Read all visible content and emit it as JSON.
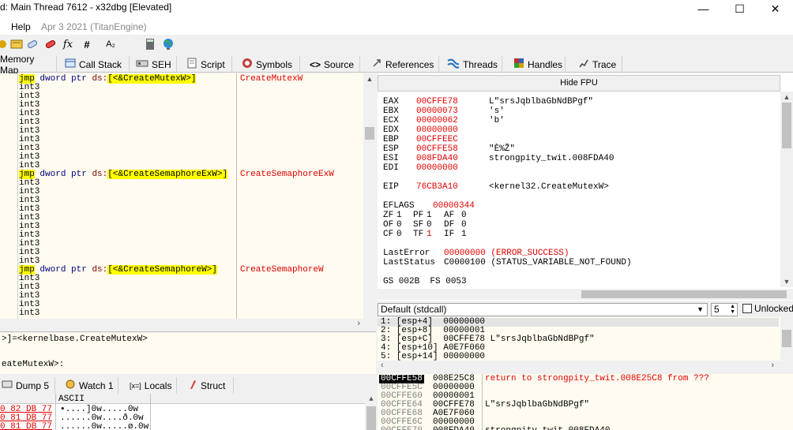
{
  "window": {
    "title": "d: Main Thread 7612 - x32dbg [Elevated]",
    "controls": [
      "—",
      "☐",
      "✕"
    ]
  },
  "menu": {
    "help": "Help",
    "build": "Apr 3 2021 (TitanEngine)"
  },
  "toolbar": {
    "icons": [
      "script-icon",
      "patch-icon",
      "bandaid-icon",
      "function-icon",
      "hash-icon",
      "font-size-icon",
      "calculator-icon",
      "globe-icon"
    ],
    "fx": "fx",
    "hash": "#",
    "font": "A₂"
  },
  "tabs": [
    {
      "label": "Memory Map",
      "icon": "memory-icon"
    },
    {
      "label": "Call Stack",
      "icon": "callstack-icon"
    },
    {
      "label": "SEH",
      "icon": "seh-icon"
    },
    {
      "label": "Script",
      "icon": "script-tab-icon"
    },
    {
      "label": "Symbols",
      "icon": "symbols-icon"
    },
    {
      "label": "Source",
      "icon": "source-icon"
    },
    {
      "label": "References",
      "icon": "references-icon"
    },
    {
      "label": "Threads",
      "icon": "threads-icon"
    },
    {
      "label": "Handles",
      "icon": "handles-icon"
    },
    {
      "label": "Trace",
      "icon": "trace-icon"
    }
  ],
  "disasm": {
    "rows": [
      {
        "type": "jmp",
        "mnemonic": "jmp",
        "kw": "dword ptr",
        "seg": "ds:",
        "target": "[<&CreateMutexW>]",
        "comment": "CreateMutexW"
      },
      {
        "type": "int3",
        "text": "int3"
      },
      {
        "type": "int3",
        "text": "int3"
      },
      {
        "type": "int3",
        "text": "int3"
      },
      {
        "type": "int3",
        "text": "int3"
      },
      {
        "type": "int3",
        "text": "int3"
      },
      {
        "type": "int3",
        "text": "int3"
      },
      {
        "type": "int3",
        "text": "int3"
      },
      {
        "type": "int3",
        "text": "int3"
      },
      {
        "type": "int3",
        "text": "int3"
      },
      {
        "type": "int3",
        "text": "int3"
      },
      {
        "type": "jmp",
        "mnemonic": "jmp",
        "kw": "dword ptr",
        "seg": "ds:",
        "target": "[<&CreateSemaphoreExW>]",
        "comment": "CreateSemaphoreExW"
      },
      {
        "type": "int3",
        "text": "int3"
      },
      {
        "type": "int3",
        "text": "int3"
      },
      {
        "type": "int3",
        "text": "int3"
      },
      {
        "type": "int3",
        "text": "int3"
      },
      {
        "type": "int3",
        "text": "int3"
      },
      {
        "type": "int3",
        "text": "int3"
      },
      {
        "type": "int3",
        "text": "int3"
      },
      {
        "type": "int3",
        "text": "int3"
      },
      {
        "type": "int3",
        "text": "int3"
      },
      {
        "type": "int3",
        "text": "int3"
      },
      {
        "type": "jmp",
        "mnemonic": "jmp",
        "kw": "dword ptr",
        "seg": "ds:",
        "target": "[<&CreateSemaphoreW>]",
        "comment": "CreateSemaphoreW"
      },
      {
        "type": "int3",
        "text": "int3"
      },
      {
        "type": "int3",
        "text": "int3"
      },
      {
        "type": "int3",
        "text": "int3"
      },
      {
        "type": "int3",
        "text": "int3"
      },
      {
        "type": "int3",
        "text": "int3"
      }
    ]
  },
  "info": {
    "line1": ">]=<kernelbase.CreateMutexW>",
    "line2": "eateMutexW>:"
  },
  "fpu": {
    "hide_label": "Hide FPU"
  },
  "registers": [
    {
      "name": "EAX",
      "value": "00CFFE78",
      "comment": "L\"srsJqblbaGbNdBPgf\""
    },
    {
      "name": "EBX",
      "value": "00000073",
      "comment": "'s'"
    },
    {
      "name": "ECX",
      "value": "00000062",
      "comment": "'b'"
    },
    {
      "name": "EDX",
      "value": "00000000",
      "comment": ""
    },
    {
      "name": "EBP",
      "value": "00CFFEEC",
      "comment": ""
    },
    {
      "name": "ESP",
      "value": "00CFFE58",
      "comment": "\"È%Ž\""
    },
    {
      "name": "ESI",
      "value": "008FDA40",
      "comment": "strongpity_twit.008FDA40"
    },
    {
      "name": "EDI",
      "value": "00000000",
      "comment": ""
    }
  ],
  "eip": {
    "name": "EIP",
    "value": "76CB3A10",
    "comment": "<kernel32.CreateMutexW>"
  },
  "eflags": {
    "name": "EFLAGS",
    "value": "00000344"
  },
  "flags": [
    [
      "ZF",
      "1",
      "PF",
      "1",
      "AF",
      "0"
    ],
    [
      "OF",
      "0",
      "SF",
      "0",
      "DF",
      "0"
    ],
    [
      "CF",
      "0",
      "TF",
      "1",
      "IF",
      "1"
    ]
  ],
  "lasterror": {
    "label": "LastError",
    "value": "00000000 (ERROR_SUCCESS)"
  },
  "laststatus": {
    "label": "LastStatus",
    "value": "C0000100 (STATUS_VARIABLE_NOT_FOUND)"
  },
  "segs": "GS 002B  FS 0053",
  "callconv": {
    "selected": "Default (stdcall)",
    "count": "5",
    "unlocked": "Unlocked"
  },
  "args": [
    "1: [esp+4]  00000000",
    "2: [esp+8]  00000001",
    "3: [esp+C]  00CFFE78 L\"srsJqblbaGbNdBPgf\"",
    "4: [esp+10] A0E7F060",
    "5: [esp+14] 00000000"
  ],
  "bottom_tabs": [
    {
      "label": "Dump 5",
      "icon": "dump-icon"
    },
    {
      "label": "Watch 1",
      "icon": "watch-icon"
    },
    {
      "label": "Locals",
      "icon": "locals-icon"
    },
    {
      "label": "Struct",
      "icon": "struct-icon"
    }
  ],
  "dump": {
    "ascii_header": "ASCII",
    "rows": [
      {
        "hex": "0 82 DB 77",
        "ascii": "▪....]0w.....0w"
      },
      {
        "hex": "0 81 DB 77",
        "ascii": "......0w....ð.0w"
      },
      {
        "hex": "0 81 DB 77",
        "ascii": "......0w.....ø.0w"
      }
    ]
  },
  "stack": {
    "rows": [
      {
        "addr": "00CFFE58",
        "val": "008E25C8",
        "comment": "return to strongpity_twit.008E25C8 from ???"
      },
      {
        "addr": "00CFFE5C",
        "val": "00000000",
        "comment": ""
      },
      {
        "addr": "00CFFE60",
        "val": "00000001",
        "comment": ""
      },
      {
        "addr": "00CFFE64",
        "val": "00CFFE78",
        "comment": "L\"srsJqblbaGbNdBPgf\""
      },
      {
        "addr": "00CFFE68",
        "val": "A0E7F060",
        "comment": ""
      },
      {
        "addr": "00CFFE6C",
        "val": "00000000",
        "comment": ""
      },
      {
        "addr": "00CFFE70",
        "val": "008FDA40",
        "comment": "strongpity_twit.008FDA40"
      }
    ]
  }
}
